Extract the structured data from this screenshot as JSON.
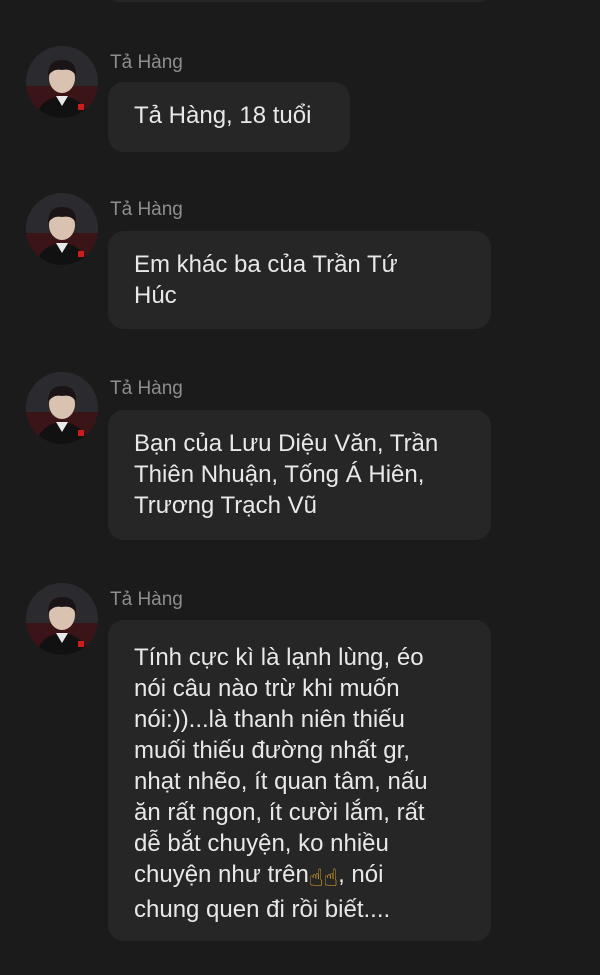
{
  "messages": [
    {
      "sender": "Tả Hàng",
      "text": "Tả Hàng, 18 tuổi"
    },
    {
      "sender": "Tả Hàng",
      "text": "Em khác ba của Trần Tứ\nHúc"
    },
    {
      "sender": "Tả Hàng",
      "text": "Bạn của Lưu Diệu Văn, Trần\nThiên Nhuận, Tống Á Hiên,\nTrương Trạch Vũ"
    },
    {
      "sender": "Tả Hàng",
      "text_before_emoji": "Tính cực kì là lạnh lùng, éo\nnói câu nào trừ khi muốn\nnói:))...là thanh niên thiếu\nmuối thiếu đường nhất gr,\nnhạt nhẽo, ít quan tâm, nấu\năn rất ngon, ít cười lắm, rất\ndễ bắt chuyện, ko nhiều\nchuyện như trên",
      "emoji": "☝☝",
      "text_after_emoji": ", nói\nchung quen đi rồi biết...."
    }
  ],
  "icons": {
    "avatar": "avatar-icon",
    "emoji": "pointing-up-emoji-icon"
  },
  "colors": {
    "background": "#1b1b1b",
    "bubble": "#262626",
    "text": "#e8e8e8",
    "sender": "#8e8e8e",
    "emoji": "#f2b227"
  }
}
